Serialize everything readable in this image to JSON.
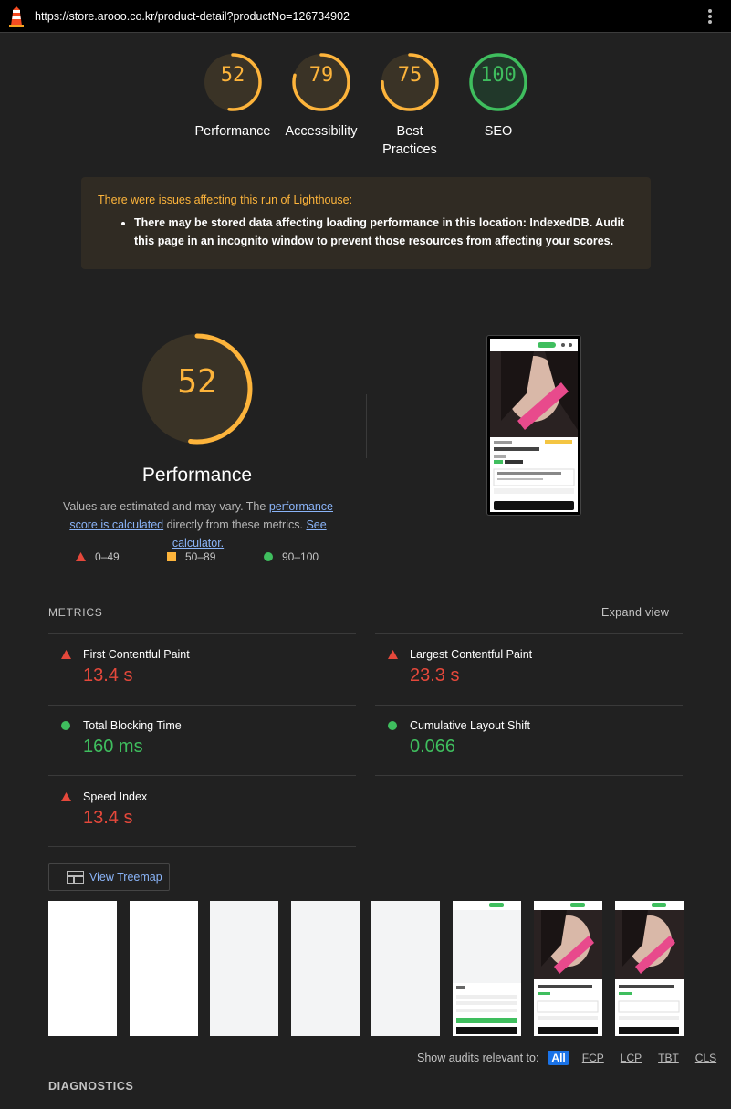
{
  "top": {
    "url": "https://store.arooo.co.kr/product-detail?productNo=126734902"
  },
  "gauges": [
    {
      "score": "52",
      "label": "Performance",
      "color": "#fdb43b",
      "fraction": 0.52
    },
    {
      "score": "79",
      "label": "Accessibility",
      "color": "#fdb43b",
      "fraction": 0.79
    },
    {
      "score": "75",
      "label_line1": "Best",
      "label_line2": "Practices",
      "color": "#fdb43b",
      "fraction": 0.75
    },
    {
      "score": "100",
      "label": "SEO",
      "color": "#3fbe5e",
      "fraction": 1.0
    }
  ],
  "warning": {
    "heading": "There were issues affecting this run of Lighthouse:",
    "item": "There may be stored data affecting loading performance in this location: IndexedDB. Audit this page in an incognito window to prevent those resources from affecting your scores."
  },
  "performance": {
    "score": "52",
    "fraction": 0.52,
    "title": "Performance",
    "desc_pre": "Values are estimated and may vary. The ",
    "desc_link1": "performance score is calculated",
    "desc_mid": " directly from these metrics. ",
    "desc_link2": "See calculator."
  },
  "legend": [
    {
      "range": "0–49",
      "icon": "triangle-icon",
      "color": "#e5483b"
    },
    {
      "range": "50–89",
      "icon": "square-icon",
      "color": "#fdb43b"
    },
    {
      "range": "90–100",
      "icon": "circle-icon",
      "color": "#3fbe5e"
    }
  ],
  "metrics": {
    "heading": "METRICS",
    "expand": "Expand view",
    "fcp": {
      "name": "First Contentful Paint",
      "value": "13.4 s",
      "status": "fail"
    },
    "lcp": {
      "name": "Largest Contentful Paint",
      "value": "23.3 s",
      "status": "fail"
    },
    "tbt": {
      "name": "Total Blocking Time",
      "value": "160 ms",
      "status": "pass"
    },
    "cls": {
      "name": "Cumulative Layout Shift",
      "value": "0.066",
      "status": "pass"
    },
    "si": {
      "name": "Speed Index",
      "value": "13.4 s",
      "status": "fail"
    }
  },
  "treemap": {
    "label": "View Treemap"
  },
  "filter": {
    "label": "Show audits relevant to:",
    "chips": [
      "All",
      "FCP",
      "LCP",
      "TBT",
      "CLS"
    ],
    "active": "All"
  },
  "diagnostics": {
    "heading": "DIAGNOSTICS"
  }
}
